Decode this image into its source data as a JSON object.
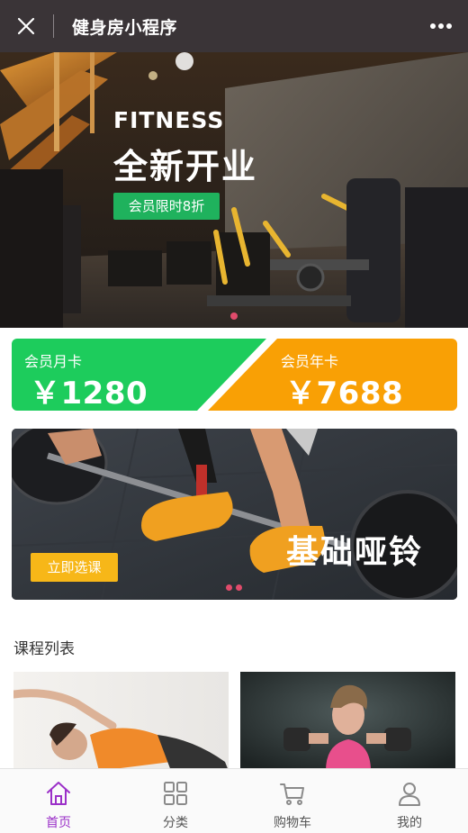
{
  "header": {
    "title": "健身房小程序",
    "close_icon": "close-icon",
    "more_icon": "more-icon"
  },
  "hero": {
    "kicker": "FITNESS",
    "title": "全新开业",
    "button": "会员限时8折"
  },
  "membership": {
    "monthly": {
      "label": "会员月卡",
      "price": "￥1280"
    },
    "yearly": {
      "label": "会员年卡",
      "price": "￥7688"
    },
    "colors": {
      "monthly": "#1dcc5c",
      "yearly": "#f9a005"
    }
  },
  "promo": {
    "title": "基础哑铃",
    "button": "立即选课"
  },
  "courses": {
    "heading": "课程列表"
  },
  "tabbar": {
    "active_color": "#9b30c8",
    "items": [
      {
        "label": "首页",
        "icon": "home-icon"
      },
      {
        "label": "分类",
        "icon": "category-grid-icon"
      },
      {
        "label": "购物车",
        "icon": "cart-icon"
      },
      {
        "label": "我的",
        "icon": "user-icon"
      }
    ]
  }
}
